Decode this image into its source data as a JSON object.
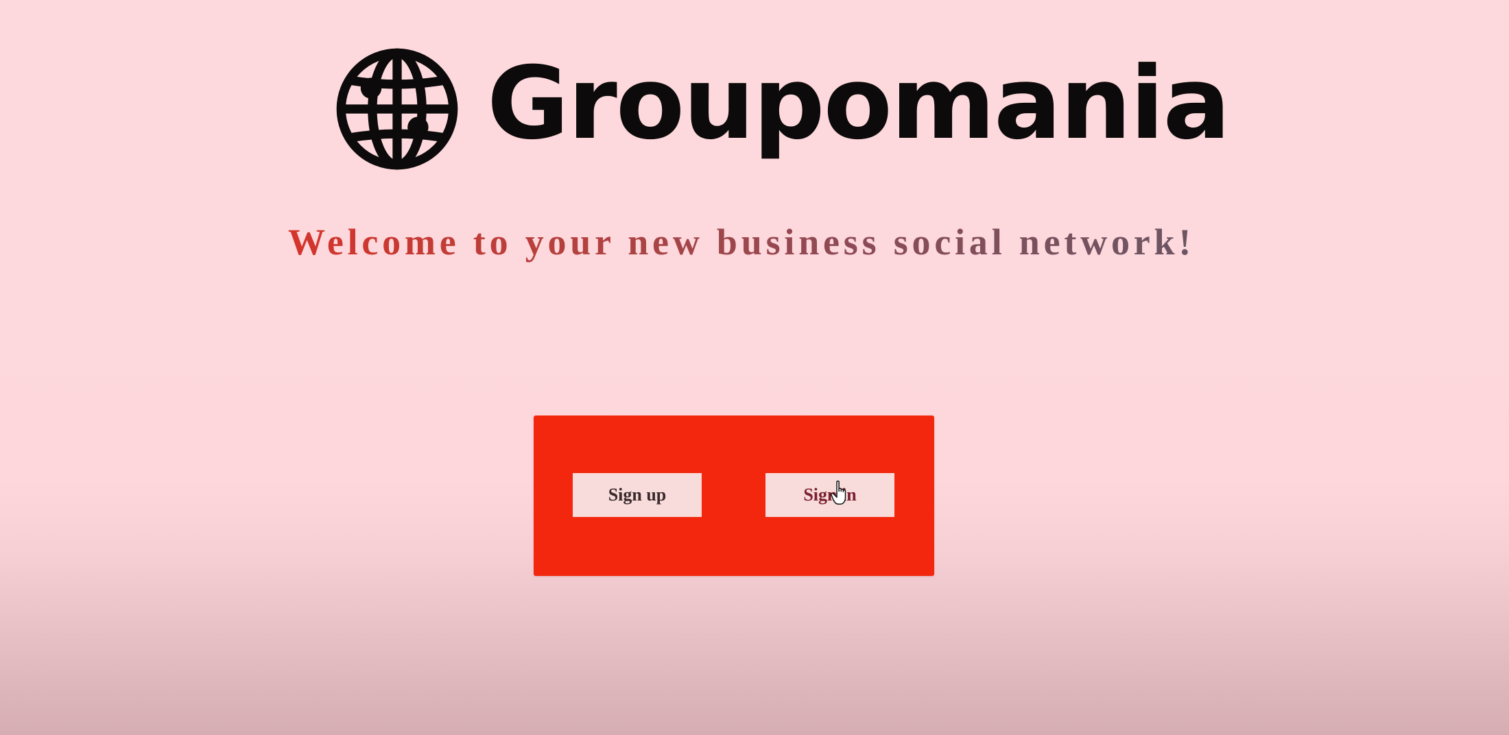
{
  "brand": {
    "name": "Groupomania",
    "logo_icon": "globe-icon"
  },
  "tagline": "Welcome to your new business social network!",
  "auth": {
    "signup_label": "Sign up",
    "signin_label": "Sign in"
  },
  "colors": {
    "background": "#fdd9dd",
    "panel": "#f2270d",
    "button": "#f8dcdc",
    "tagline_start": "#d5342a",
    "tagline_end": "#6c5563",
    "logo": "#0c0a0a"
  },
  "cursor_icon": "hand-pointer-icon"
}
